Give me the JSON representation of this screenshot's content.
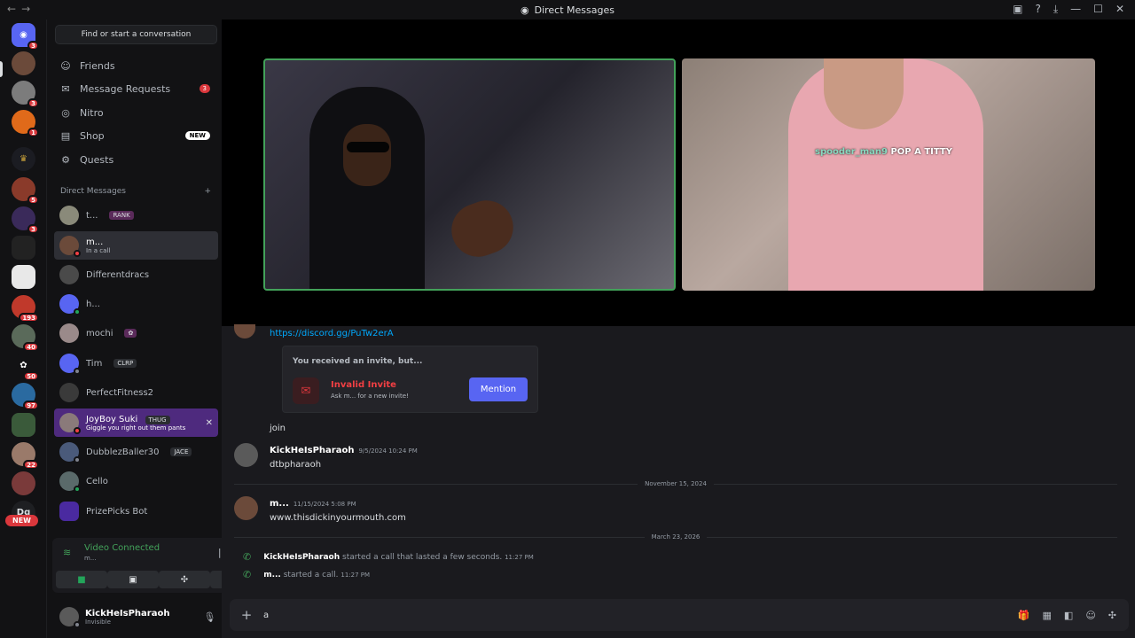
{
  "titlebar": {
    "title": "Direct Messages"
  },
  "guilds": {
    "badges": [
      "3",
      "3",
      "1",
      "5",
      "3",
      "193",
      "40",
      "50",
      "97",
      "22"
    ],
    "dg_label": "Dg",
    "new_label": "NEW"
  },
  "sidebar": {
    "search_label": "Find or start a conversation",
    "nav": [
      {
        "label": "Friends"
      },
      {
        "label": "Message Requests",
        "badge": "3"
      },
      {
        "label": "Nitro"
      },
      {
        "label": "Shop",
        "badge": "NEW"
      },
      {
        "label": "Quests"
      }
    ],
    "dm_header": "Direct Messages",
    "dm_add": "+",
    "dms": [
      {
        "name": "t...",
        "tag": "RANK"
      },
      {
        "name": "m...",
        "sub": "In a call"
      },
      {
        "name": "Differentdracs"
      },
      {
        "name": "h..."
      },
      {
        "name": "mochi"
      },
      {
        "name": "Tim",
        "tag": "CLRP"
      },
      {
        "name": "PerfectFitness2"
      },
      {
        "name": "JoyBoy Suki",
        "tag": "THUG",
        "sub": "Giggle you right out them pants"
      },
      {
        "name": "DubblezBaller30",
        "tag": "JACE"
      },
      {
        "name": "Cello"
      },
      {
        "name": "PrizePicks Bot"
      }
    ]
  },
  "voice": {
    "status": "Video Connected",
    "channel": "m..."
  },
  "user": {
    "name": "KickHeIsPharaoh",
    "status": "Invisible"
  },
  "call": {
    "caption_user": "spooder_man9",
    "caption_text": "POP A TITTY"
  },
  "messages": {
    "invite_link": "https://discord.gg/PuTw2erA",
    "invite_title": "You received an invite, but...",
    "invite_name": "Invalid Invite",
    "invite_sub": "Ask m... for a new invite!",
    "invite_button": "Mention",
    "join_text": "join",
    "m1": {
      "author": "KickHeIsPharaoh",
      "time": "9/5/2024 10:24 PM",
      "text": "dtbpharaoh"
    },
    "divider1": "November 15, 2024",
    "m2": {
      "author": "m...",
      "time": "11/15/2024 5:08 PM",
      "text": "www.thisdickinyourmouth.com"
    },
    "divider2": "March 23, 2026",
    "sys1": {
      "author": "KickHeIsPharaoh",
      "text": "started a call that lasted a few seconds.",
      "time": "11:27 PM"
    },
    "sys2": {
      "author": "m...",
      "text": "started a call.",
      "time": "11:27 PM"
    }
  },
  "composer": {
    "value": "a"
  }
}
